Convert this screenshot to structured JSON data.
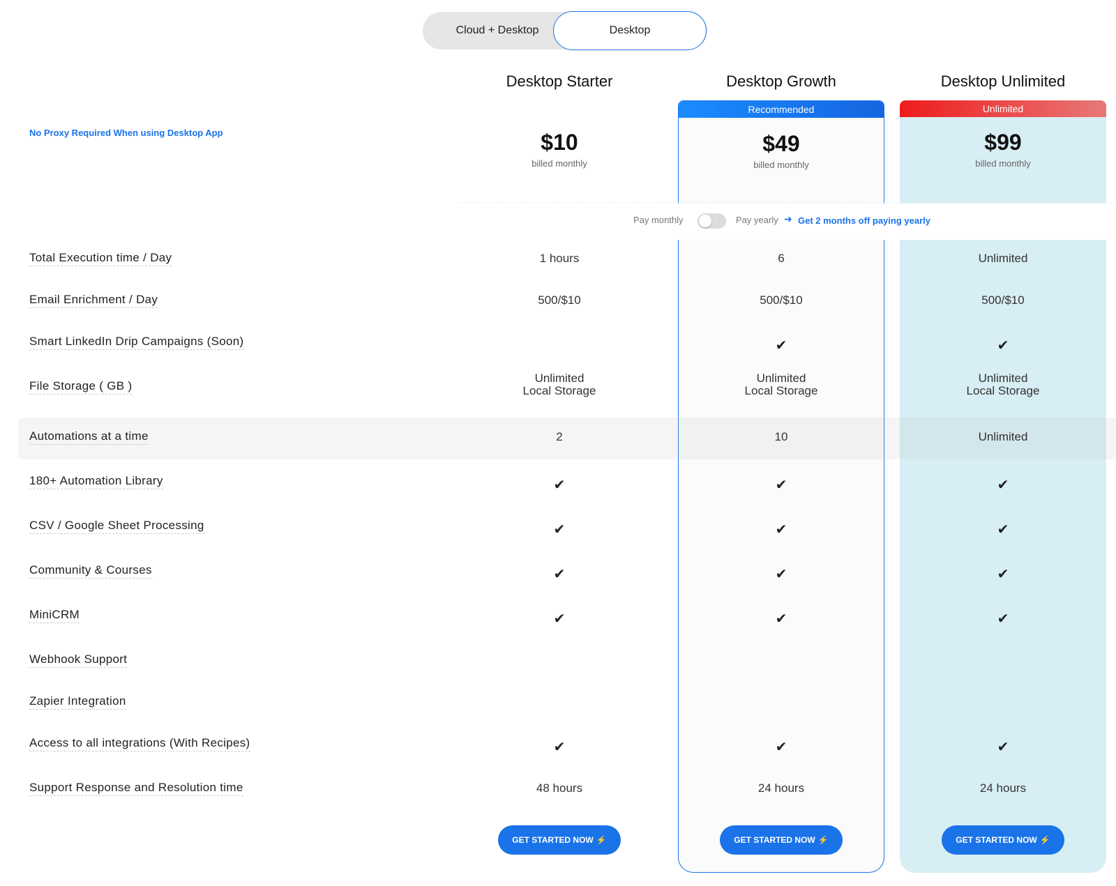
{
  "segment": {
    "options": [
      "Cloud + Desktop",
      "Desktop"
    ],
    "selected": "Desktop"
  },
  "proxy_note": "No Proxy Required When using Desktop App",
  "plans": [
    {
      "name": "Desktop Starter",
      "price": "$10",
      "billing": "billed monthly",
      "badge": "",
      "button": "GET STARTED NOW"
    },
    {
      "name": "Desktop Growth",
      "price": "$49",
      "billing": "billed monthly",
      "badge": "Recommended",
      "button": "GET STARTED NOW"
    },
    {
      "name": "Desktop Unlimited",
      "price": "$99",
      "billing": "billed monthly",
      "badge": "Unlimited",
      "button": "GET STARTED NOW"
    }
  ],
  "billing_toggle": {
    "monthly_label": "Pay monthly",
    "yearly_label": "Pay yearly",
    "offer": "Get 2 months off paying yearly",
    "yearly_on": false
  },
  "features": [
    {
      "label": "Total Execution time / Day",
      "values": [
        "1 hours",
        "6",
        "Unlimited"
      ]
    },
    {
      "label": "Email Enrichment / Day",
      "values": [
        "500/$10",
        "500/$10",
        "500/$10"
      ]
    },
    {
      "label": "Smart LinkedIn Drip Campaigns (Soon)",
      "values": [
        "",
        "check",
        "check"
      ]
    },
    {
      "label": "File Storage ( GB )",
      "values": [
        "Unlimited\nLocal Storage",
        "Unlimited\nLocal Storage",
        "Unlimited\nLocal Storage"
      ]
    },
    {
      "label": "Automations at a time",
      "values": [
        "2",
        "10",
        "Unlimited"
      ]
    },
    {
      "label": "180+ Automation Library",
      "values": [
        "check",
        "check",
        "check"
      ]
    },
    {
      "label": "CSV / Google Sheet Processing",
      "values": [
        "check",
        "check",
        "check"
      ]
    },
    {
      "label": "Community & Courses",
      "values": [
        "check",
        "check",
        "check"
      ]
    },
    {
      "label": "MiniCRM",
      "values": [
        "check",
        "check",
        "check"
      ]
    },
    {
      "label": "Webhook Support",
      "values": [
        "",
        "",
        ""
      ]
    },
    {
      "label": "Zapier Integration",
      "values": [
        "",
        "",
        ""
      ]
    },
    {
      "label": "Access to all integrations (With Recipes)",
      "values": [
        "check",
        "check",
        "check"
      ]
    },
    {
      "label": "Support Response and Resolution time",
      "values": [
        "48 hours",
        "24 hours",
        "24 hours"
      ]
    }
  ],
  "colors": {
    "accent": "#1a73e8",
    "unlimited_bg": "#d8eef5",
    "badge_red": "#ee1c1c"
  },
  "icons": {
    "check": "check-icon",
    "bolt": "bolt-icon",
    "arrow": "arrow-right-icon"
  }
}
